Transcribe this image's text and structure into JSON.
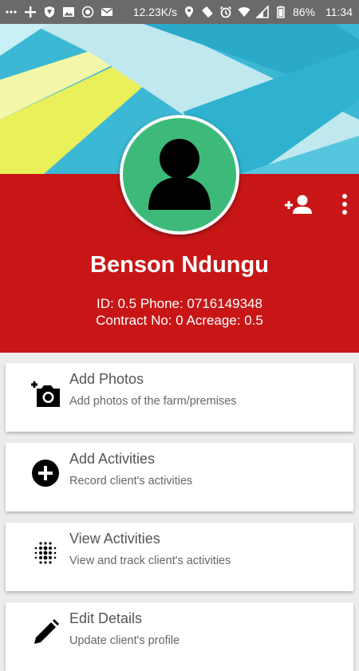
{
  "status_bar": {
    "speed": "12.23K/s",
    "battery": "86%",
    "time": "11:34"
  },
  "profile": {
    "name": "Benson Ndungu",
    "info_line1": "ID: 0.5 Phone: 0716149348",
    "info_line2": "Contract No: 0 Acreage: 0.5"
  },
  "actions": [
    {
      "title": "Add Photos",
      "subtitle": "Add photos of the farm/premises",
      "icon": "add-photo-icon"
    },
    {
      "title": "Add Activities",
      "subtitle": "Record client's activities",
      "icon": "add-circle-icon"
    },
    {
      "title": "View Activities",
      "subtitle": "View and track client's activities",
      "icon": "dots-grid-icon"
    },
    {
      "title": "Edit Details",
      "subtitle": "Update client's profile",
      "icon": "pencil-icon"
    }
  ],
  "colors": {
    "header_red": "#c81617",
    "avatar_green": "#3dba7a",
    "status_bar": "#6a6a6a"
  }
}
